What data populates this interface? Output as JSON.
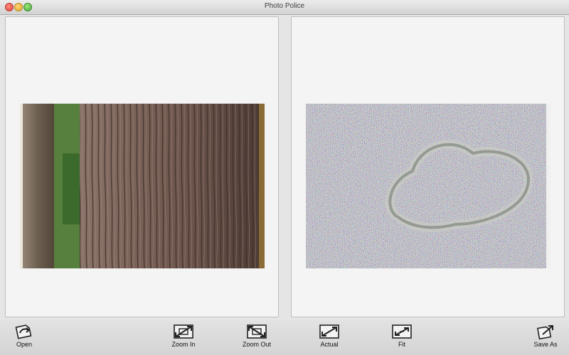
{
  "window": {
    "title": "Photo Police"
  },
  "toolbar": {
    "open_label": "Open",
    "zoom_in_label": "Zoom In",
    "zoom_out_label": "Zoom Out",
    "actual_label": "Actual",
    "fit_label": "Fit",
    "save_as_label": "Save As"
  },
  "icons": {
    "open": "open-icon",
    "zoom_in": "zoom-in-icon",
    "zoom_out": "zoom-out-icon",
    "actual": "actual-size-icon",
    "fit": "fit-icon",
    "save_as": "save-as-icon"
  },
  "colors": {
    "window_bg": "#e5e5e5",
    "panel_bg": "#f4f4f4",
    "close": "#e0443a",
    "minimize": "#e2a725",
    "zoom": "#4aa93a"
  }
}
